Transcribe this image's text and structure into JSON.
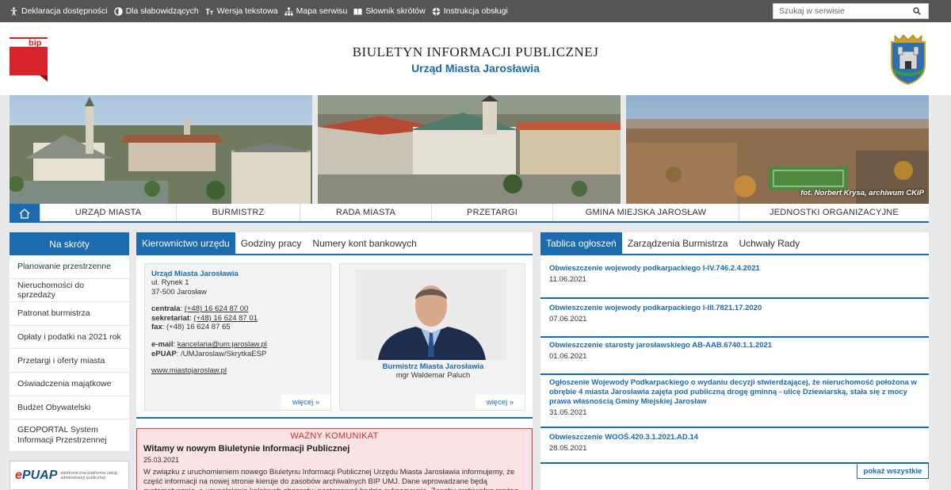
{
  "topbar": {
    "links": [
      {
        "label": "Deklaracja dostępności",
        "icon": "accessibility-icon"
      },
      {
        "label": "Dla słabowidzących",
        "icon": "contrast-icon"
      },
      {
        "label": "Wersja tekstowa",
        "icon": "text-version-icon"
      },
      {
        "label": "Mapa serwisu",
        "icon": "sitemap-icon"
      },
      {
        "label": "Słownik skrótów",
        "icon": "book-icon"
      },
      {
        "label": "Instrukcja obsługi",
        "icon": "help-icon"
      }
    ],
    "search_placeholder": "Szukaj w serwisie"
  },
  "header": {
    "logo_text": "bip",
    "title_line1": "BIULETYN INFORMACJI PUBLICZNEJ",
    "title_line2": "Urząd Miasta Jarosławia"
  },
  "banner": {
    "photo_credit": "fot. Norbert Krysa, archiwum CKiP"
  },
  "nav": {
    "items": [
      "URZĄD MIASTA",
      "BURMISTRZ",
      "RADA MIASTA",
      "PRZETARGI",
      "GMINA MIEJSKA JAROSŁAW",
      "JEDNOSTKI ORGANIZACYJNE"
    ]
  },
  "sidebar": {
    "title": "Na skróty",
    "items": [
      "Planowanie przestrzenne",
      "Nieruchomości do sprzedaży",
      "Patronat burmistrza",
      "Opłaty i podatki na 2021 rok",
      "Przetargi i oferty miasta",
      "Oświadczenia majątkowe",
      "Budżet Obywatelski",
      "GEOPORTAL System Informacji Przestrzennej"
    ],
    "epuap": {
      "logo_e": "e",
      "logo_rest": "PUAP",
      "sub": "elektroniczna platforma usług administracji publicznej"
    }
  },
  "middle": {
    "tabs": [
      "Kierownictwo urzędu",
      "Godziny pracy",
      "Numery kont bankowych"
    ],
    "contact": {
      "org": "Urząd Miasta Jarosławia",
      "street": "ul. Rynek 1",
      "city": "37-500 Jarosław",
      "centrala_label": "centrala",
      "centrala": "(+48) 16 624 87 00",
      "sekretariat_label": "sekretariat",
      "sekretariat": "(+48) 16 624 87 01",
      "fax_label": "fax",
      "fax": "(+48) 16 624 87 65",
      "email_label": "e-mail",
      "email": "kancelaria@um.jaroslaw.pl",
      "epuap_label": "ePUAP",
      "epuap": "/UMJaroslaw/SkrytkaESP",
      "www": "www.miastojaroslaw.pl",
      "more": "więcej »"
    },
    "mayor": {
      "caption": "Burmistrz Miasta Jarosławia",
      "name": "mgr Waldemar Paluch",
      "more": "więcej »"
    },
    "notice": {
      "header": "WAŻNY KOMUNIKAT",
      "title": "Witamy w nowym Biuletynie Informacji Publicznej",
      "date": "25.03.2021",
      "body": "W związku z uruchomieniem nowego Biuletynu Informacji Publicznej Urzędu Miasta Jarosławia informujemy, że część informacji na nowej stronie kieruje do zasobów archiwalnych BIP UMJ. Dane wprowadzane będą systematycznie, a uzupełnienie kolejnych obszarów postępować będzie sukcesywnie. Zasoby archiwalne można obejrzeć tutaj"
    }
  },
  "right": {
    "tabs": [
      "Tablica ogłoszeń",
      "Zarządzenia Burmistrza",
      "Uchwały Rady"
    ],
    "announcements": [
      {
        "title": "Obwieszczenie wojewody podkarpackiego I-IV.746.2.4.2021",
        "date": "11.06.2021"
      },
      {
        "title": "Obwieszczenie wojewody podkarpackiego I-III.7821.17.2020",
        "date": "07.06.2021"
      },
      {
        "title": "Obwieszczenie starosty jarosławskiego AB-AAB.6740.1.1.2021",
        "date": "01.06.2021"
      },
      {
        "title": "Ogłoszenie Wojewody Podkarpackiego o wydaniu decyzji stwierdzającej, że nieruchomość położona w obrębie 4 miasta Jarosławia zajęta pod publiczną drogę gminną - ulicę Dziewiarską, stała się z mocy prawa własnością Gminy Miejskiej Jarosław",
        "date": "31.05.2021"
      },
      {
        "title": "Obwieszczenie WOOŚ.420.3.1.2021.AD.14",
        "date": "28.05.2021"
      }
    ],
    "show_all": "pokaż wszystkie"
  }
}
